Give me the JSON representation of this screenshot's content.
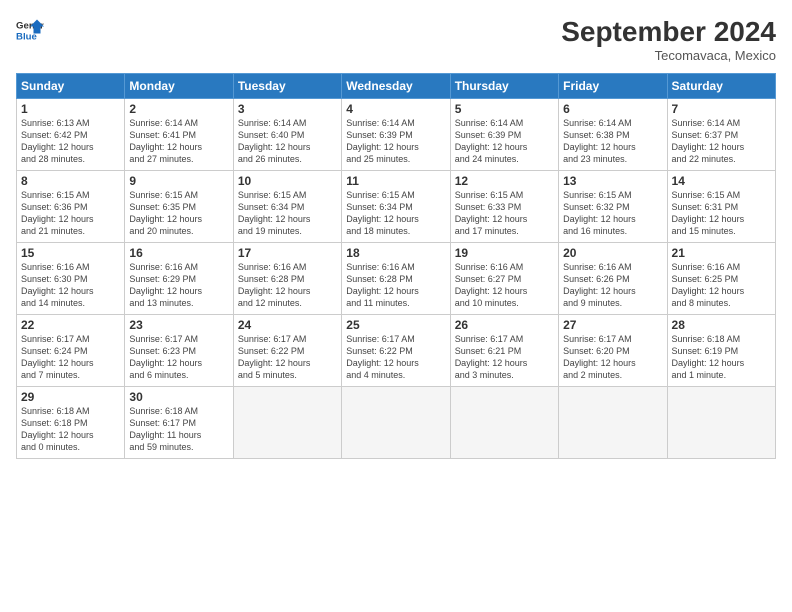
{
  "header": {
    "logo_text_general": "General",
    "logo_text_blue": "Blue",
    "month_title": "September 2024",
    "location": "Tecomavaca, Mexico"
  },
  "weekdays": [
    "Sunday",
    "Monday",
    "Tuesday",
    "Wednesday",
    "Thursday",
    "Friday",
    "Saturday"
  ],
  "weeks": [
    [
      {
        "day": "1",
        "info": "Sunrise: 6:13 AM\nSunset: 6:42 PM\nDaylight: 12 hours\nand 28 minutes."
      },
      {
        "day": "2",
        "info": "Sunrise: 6:14 AM\nSunset: 6:41 PM\nDaylight: 12 hours\nand 27 minutes."
      },
      {
        "day": "3",
        "info": "Sunrise: 6:14 AM\nSunset: 6:40 PM\nDaylight: 12 hours\nand 26 minutes."
      },
      {
        "day": "4",
        "info": "Sunrise: 6:14 AM\nSunset: 6:39 PM\nDaylight: 12 hours\nand 25 minutes."
      },
      {
        "day": "5",
        "info": "Sunrise: 6:14 AM\nSunset: 6:39 PM\nDaylight: 12 hours\nand 24 minutes."
      },
      {
        "day": "6",
        "info": "Sunrise: 6:14 AM\nSunset: 6:38 PM\nDaylight: 12 hours\nand 23 minutes."
      },
      {
        "day": "7",
        "info": "Sunrise: 6:14 AM\nSunset: 6:37 PM\nDaylight: 12 hours\nand 22 minutes."
      }
    ],
    [
      {
        "day": "8",
        "info": "Sunrise: 6:15 AM\nSunset: 6:36 PM\nDaylight: 12 hours\nand 21 minutes."
      },
      {
        "day": "9",
        "info": "Sunrise: 6:15 AM\nSunset: 6:35 PM\nDaylight: 12 hours\nand 20 minutes."
      },
      {
        "day": "10",
        "info": "Sunrise: 6:15 AM\nSunset: 6:34 PM\nDaylight: 12 hours\nand 19 minutes."
      },
      {
        "day": "11",
        "info": "Sunrise: 6:15 AM\nSunset: 6:34 PM\nDaylight: 12 hours\nand 18 minutes."
      },
      {
        "day": "12",
        "info": "Sunrise: 6:15 AM\nSunset: 6:33 PM\nDaylight: 12 hours\nand 17 minutes."
      },
      {
        "day": "13",
        "info": "Sunrise: 6:15 AM\nSunset: 6:32 PM\nDaylight: 12 hours\nand 16 minutes."
      },
      {
        "day": "14",
        "info": "Sunrise: 6:15 AM\nSunset: 6:31 PM\nDaylight: 12 hours\nand 15 minutes."
      }
    ],
    [
      {
        "day": "15",
        "info": "Sunrise: 6:16 AM\nSunset: 6:30 PM\nDaylight: 12 hours\nand 14 minutes."
      },
      {
        "day": "16",
        "info": "Sunrise: 6:16 AM\nSunset: 6:29 PM\nDaylight: 12 hours\nand 13 minutes."
      },
      {
        "day": "17",
        "info": "Sunrise: 6:16 AM\nSunset: 6:28 PM\nDaylight: 12 hours\nand 12 minutes."
      },
      {
        "day": "18",
        "info": "Sunrise: 6:16 AM\nSunset: 6:28 PM\nDaylight: 12 hours\nand 11 minutes."
      },
      {
        "day": "19",
        "info": "Sunrise: 6:16 AM\nSunset: 6:27 PM\nDaylight: 12 hours\nand 10 minutes."
      },
      {
        "day": "20",
        "info": "Sunrise: 6:16 AM\nSunset: 6:26 PM\nDaylight: 12 hours\nand 9 minutes."
      },
      {
        "day": "21",
        "info": "Sunrise: 6:16 AM\nSunset: 6:25 PM\nDaylight: 12 hours\nand 8 minutes."
      }
    ],
    [
      {
        "day": "22",
        "info": "Sunrise: 6:17 AM\nSunset: 6:24 PM\nDaylight: 12 hours\nand 7 minutes."
      },
      {
        "day": "23",
        "info": "Sunrise: 6:17 AM\nSunset: 6:23 PM\nDaylight: 12 hours\nand 6 minutes."
      },
      {
        "day": "24",
        "info": "Sunrise: 6:17 AM\nSunset: 6:22 PM\nDaylight: 12 hours\nand 5 minutes."
      },
      {
        "day": "25",
        "info": "Sunrise: 6:17 AM\nSunset: 6:22 PM\nDaylight: 12 hours\nand 4 minutes."
      },
      {
        "day": "26",
        "info": "Sunrise: 6:17 AM\nSunset: 6:21 PM\nDaylight: 12 hours\nand 3 minutes."
      },
      {
        "day": "27",
        "info": "Sunrise: 6:17 AM\nSunset: 6:20 PM\nDaylight: 12 hours\nand 2 minutes."
      },
      {
        "day": "28",
        "info": "Sunrise: 6:18 AM\nSunset: 6:19 PM\nDaylight: 12 hours\nand 1 minute."
      }
    ],
    [
      {
        "day": "29",
        "info": "Sunrise: 6:18 AM\nSunset: 6:18 PM\nDaylight: 12 hours\nand 0 minutes."
      },
      {
        "day": "30",
        "info": "Sunrise: 6:18 AM\nSunset: 6:17 PM\nDaylight: 11 hours\nand 59 minutes."
      },
      {
        "day": "",
        "info": ""
      },
      {
        "day": "",
        "info": ""
      },
      {
        "day": "",
        "info": ""
      },
      {
        "day": "",
        "info": ""
      },
      {
        "day": "",
        "info": ""
      }
    ]
  ]
}
